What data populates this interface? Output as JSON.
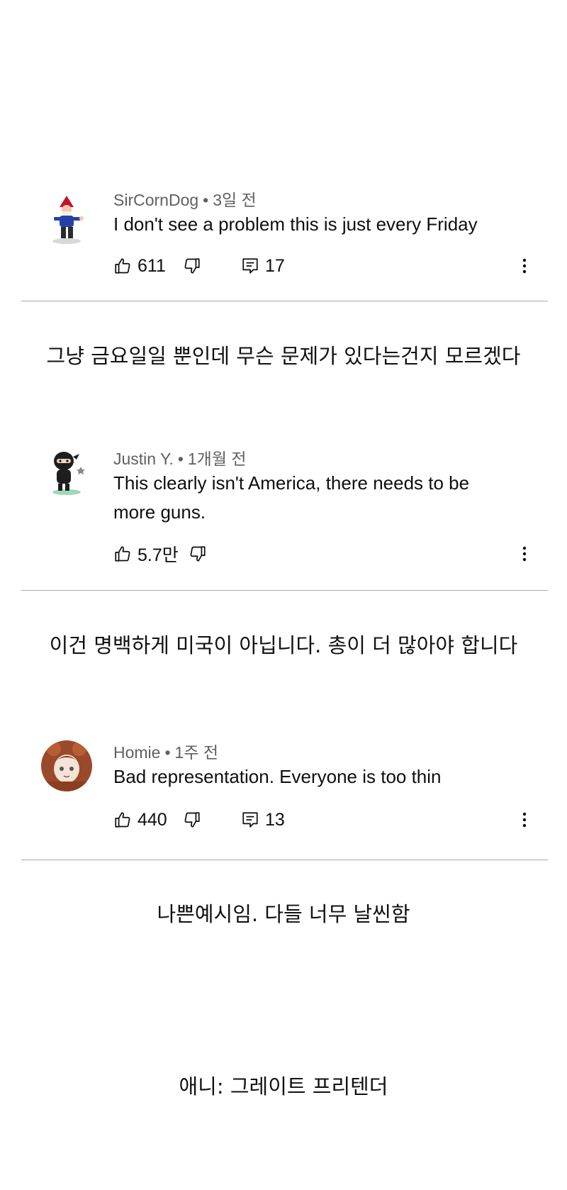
{
  "comments": [
    {
      "author": "SirCornDog",
      "sep": "•",
      "time": "3일 전",
      "text": "I don't see a problem this is just every Friday",
      "likes": "611",
      "replies": "17",
      "avatar_icon": "gnome-avatar-icon"
    },
    {
      "author": "Justin Y.",
      "sep": "•",
      "time": "1개월 전",
      "text": "This clearly isn't America, there needs to be more guns.",
      "likes": "5.7만",
      "replies": "",
      "avatar_icon": "ninja-avatar-icon"
    },
    {
      "author": "Homie",
      "sep": "•",
      "time": "1주 전",
      "text": "Bad representation. Everyone is too thin",
      "likes": "440",
      "replies": "13",
      "avatar_icon": "anime-character-avatar-icon"
    }
  ],
  "translations": [
    "그냥 금요일일 뿐인데 무슨 문제가 있다는건지 모르겠다",
    "이건 명백하게 미국이 아닙니다. 총이 더 많아야 합니다",
    "나쁜예시임. 다들 너무 날씬함"
  ],
  "caption": "애니: 그레이트 프리텐더",
  "colors": {
    "meta": "#606060",
    "divider": "#a9a9a9",
    "text": "#0f0f0f"
  }
}
